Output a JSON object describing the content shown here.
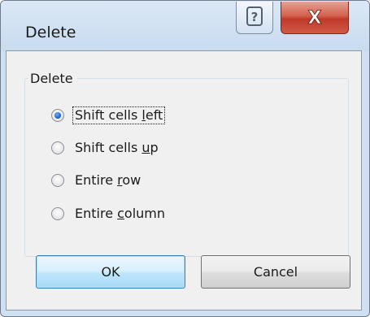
{
  "dialog": {
    "title": "Delete",
    "help_glyph": "?",
    "close_glyph": "X"
  },
  "group": {
    "label": "Delete"
  },
  "options": [
    {
      "label": "Shift cells left",
      "mnemonic": "l",
      "checked": true
    },
    {
      "label": "Shift cells up",
      "mnemonic": "u",
      "checked": false
    },
    {
      "label": "Entire row",
      "mnemonic": "r",
      "checked": false
    },
    {
      "label": "Entire column",
      "mnemonic": "c",
      "checked": false
    }
  ],
  "buttons": {
    "ok_label": "OK",
    "cancel_label": "Cancel"
  },
  "colors": {
    "close_button": "#c8412d",
    "default_button_border": "#3c7fb1",
    "radio_selected": "#1f63c7"
  }
}
